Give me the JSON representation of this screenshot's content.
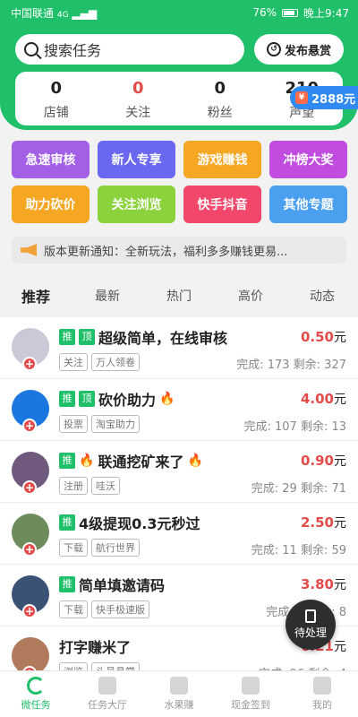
{
  "status_bar": {
    "carrier": "中国联通",
    "network": "4G",
    "battery": "76%",
    "time": "晚上9:47"
  },
  "search": {
    "placeholder": "搜索任务",
    "icon": "search-icon"
  },
  "publish_button": {
    "label": "发布悬赏",
    "icon": "publish-icon"
  },
  "stats": [
    {
      "value": "0",
      "label": "店铺"
    },
    {
      "value": "0",
      "label": "关注"
    },
    {
      "value": "0",
      "label": "粉丝"
    },
    {
      "value": "210",
      "label": "声望"
    }
  ],
  "wallet": {
    "amount": "2888元",
    "icon": "red-packet-icon"
  },
  "categories": [
    {
      "label": "急速审核",
      "color": "#a35fe6"
    },
    {
      "label": "新人专享",
      "color": "#6a67f0"
    },
    {
      "label": "游戏赚钱",
      "color": "#f5a623"
    },
    {
      "label": "冲榜大奖",
      "color": "#c04de0"
    },
    {
      "label": "助力砍价",
      "color": "#f5a623"
    },
    {
      "label": "关注浏览",
      "color": "#8bd23c"
    },
    {
      "label": "快手抖音",
      "color": "#f0476b"
    },
    {
      "label": "其他专题",
      "color": "#4aa0ef"
    }
  ],
  "notice": {
    "text": "版本更新通知：全新玩法，福利多多赚钱更易...",
    "icon": "horn-icon"
  },
  "tabs": [
    "推荐",
    "最新",
    "热门",
    "高价",
    "动态"
  ],
  "tasks": [
    {
      "badges": [
        "推",
        "顶"
      ],
      "title": "超级简单，在线审核",
      "flame": false,
      "tags": [
        "关注",
        "万人领卷"
      ],
      "price": "0.50",
      "unit": "元",
      "done": "完成: 173",
      "remaining": "剩余: 327",
      "avatar_color": "#c9c9d8"
    },
    {
      "badges": [
        "推",
        "顶"
      ],
      "title": "砍价助力",
      "flame": true,
      "tags": [
        "投票",
        "淘宝助力"
      ],
      "price": "4.00",
      "unit": "元",
      "done": "完成: 107",
      "remaining": "剩余: 13",
      "avatar_color": "#1b77e0"
    },
    {
      "badges": [
        "推"
      ],
      "title": "联通挖矿来了",
      "flame": true,
      "tags": [
        "注册",
        "哇沃"
      ],
      "price": "0.90",
      "unit": "元",
      "done": "完成: 29",
      "remaining": "剩余: 71",
      "avatar_color": "#6f5a7e"
    },
    {
      "badges": [
        "推"
      ],
      "title": "4级提现0.3元秒过",
      "flame": false,
      "tags": [
        "下载",
        "航行世界"
      ],
      "price": "2.50",
      "unit": "元",
      "done": "完成: 11",
      "remaining": "剩余: 59",
      "avatar_color": "#6e8c5b"
    },
    {
      "badges": [
        "推"
      ],
      "title": "简单填邀请码",
      "flame": false,
      "tags": [
        "下载",
        "快手极速版"
      ],
      "price": "3.80",
      "unit": "元",
      "done": "完成: 2",
      "remaining": "剩余: 8",
      "avatar_color": "#3a5274"
    },
    {
      "badges": [],
      "title": "打字赚米了",
      "flame": false,
      "tags": [
        "浏览",
        "头号悬赏"
      ],
      "price": "0.21",
      "unit": "元",
      "done": "完成: 96",
      "remaining": "剩余: 4",
      "avatar_color": "#b07a5c"
    }
  ],
  "float_button": {
    "label": "待处理",
    "icon": "clipboard-icon"
  },
  "bottom_nav": [
    {
      "label": "微任务",
      "icon": "refresh-icon",
      "active": true
    },
    {
      "label": "任务大厅",
      "icon": "grid-icon",
      "active": false
    },
    {
      "label": "水果赚",
      "icon": "fruit-icon",
      "active": false
    },
    {
      "label": "现金签到",
      "icon": "calendar-icon",
      "active": false
    },
    {
      "label": "我的",
      "icon": "user-icon",
      "active": false
    }
  ]
}
